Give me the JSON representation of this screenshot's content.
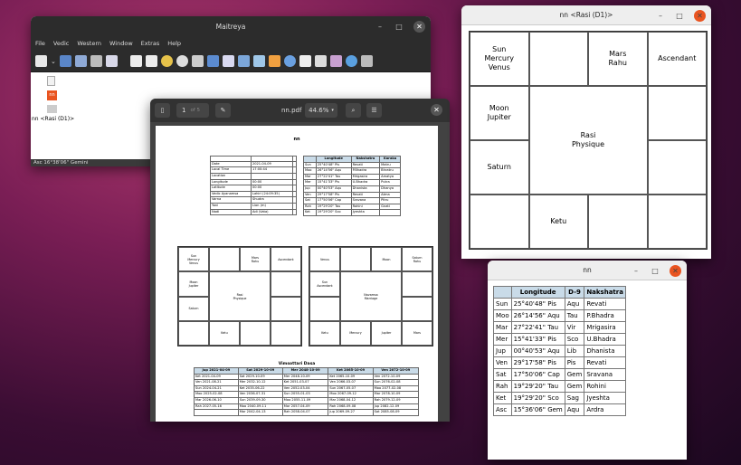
{
  "maitreya": {
    "title": "Maitreya",
    "menu": [
      "File",
      "Vedic",
      "Western",
      "Window",
      "Extras",
      "Help"
    ],
    "files": [
      {
        "name": "",
        "icon": "document-icon"
      },
      {
        "name": "",
        "icon": "nn-file-icon"
      },
      {
        "name": "",
        "icon": "dd-file-icon"
      },
      {
        "name": "nn <Rasi (D1)>",
        "icon": ""
      }
    ],
    "status": "Asc 16°38'06\" Gemini"
  },
  "pdf": {
    "title": "nn.pdf",
    "page_number": "1",
    "page_total": "of 5",
    "zoom": "44.6%",
    "doc_title": "nn",
    "basic_rows": [
      [
        "",
        "",
        ""
      ],
      [
        "Date",
        "2021-04-09",
        ""
      ],
      [
        "Local Time",
        "17:00:44",
        ""
      ],
      [
        "Location",
        "",
        ""
      ],
      [
        "Longitude",
        "00:00",
        ""
      ],
      [
        "Latitude",
        "00:00",
        ""
      ],
      [
        "Vedic Ayanamsa",
        "Lahiri (24:09:35)",
        ""
      ],
      [
        "Varna",
        "Shudra",
        ""
      ],
      [
        "Yoni",
        "Lion (m)",
        ""
      ],
      [
        "Nadi",
        "Adi (Vata)",
        ""
      ]
    ],
    "planet_headers": [
      "",
      "Longitude",
      "Nakshatra",
      "Karaka"
    ],
    "planet_rows": [
      [
        "Sun",
        "25°40'48\" Pis",
        "Revati",
        "Matru"
      ],
      [
        "Moo",
        "26°14'56\" Aqu",
        "P.Bhadra",
        "Bhratru"
      ],
      [
        "Mar",
        "27°22'41\" Tau",
        "Mrigasira",
        "Amatya"
      ],
      [
        "Mer",
        "15°41'33\" Pis",
        "U.Bhadra",
        "Putra"
      ],
      [
        "Jup",
        "00°40'53\" Aqu",
        "Dhanista",
        "Dhanya"
      ],
      [
        "Ven",
        "29°17'58\" Pis",
        "Revati",
        "Atma"
      ],
      [
        "Sat",
        "17°50'06\" Cap",
        "Sravana",
        "Pitru"
      ],
      [
        "Rah",
        "19°29'20\" Tau",
        "Rohini",
        "Gnati"
      ],
      [
        "Ket",
        "19°29'20\" Sco",
        "Jyeshta",
        ""
      ]
    ],
    "rasi_cells": {
      "c00": "Sun\nMercury\nVenus",
      "c01": "",
      "c02": "Mars\nRahu",
      "c03": "Ascendant",
      "c10": "Moon\nJupiter",
      "c13": "",
      "c20": "",
      "c23": "",
      "c30": "Saturn",
      "c31": "Ketu",
      "c32": "",
      "c33": "",
      "center": "Rasi\nPhysique"
    },
    "rasi_small_cells": {
      "c00": "Sun\nMercury\nVenus",
      "c01": "",
      "c02": "Mars\nRahu",
      "c03": "Ascendant",
      "c10": "Moon\nJupiter",
      "c13": "",
      "c20": "Saturn",
      "c23": "",
      "c30": "",
      "c31": "Ketu",
      "c32": "",
      "c33": "",
      "center": "Rasi\nPhysique"
    },
    "navamsa_cells": {
      "c00": "Venus",
      "c01": "",
      "c02": "Moon",
      "c03": "Saturn\nRahu",
      "c10": "Sun\nAscendant",
      "c13": "",
      "c20": "",
      "c23": "",
      "c30": "Ketu",
      "c31": "Mercury",
      "c32": "Jupiter",
      "c33": "Mars",
      "center": "Navamsa\nMarriage"
    },
    "dasa_title": "Vimsottari Dasa",
    "dasa_headers": [
      "Jup 2021-04-09",
      "Sat 2029-10-09",
      "Mer 2048-10-09",
      "Ket 2065-10-09",
      "Ven 2072-10-09"
    ],
    "dasa_rows": [
      [
        "Ket 2021-04-09",
        "Sat 2029-10-09",
        "Mer 2048-10-09",
        "Ket 2065-10-09",
        "Ven 2072-10-09"
      ],
      [
        "Ven 2021-08-21",
        "Mer 2032-10-12",
        "Ket 2051-03-07",
        "Ven 2066-03-07",
        "Sun 2076-02-08"
      ],
      [
        "Sun 2024-04-21",
        "Ket 2035-06-22",
        "Ven 2052-03-04",
        "Sun 2067-05-07",
        "Moo 2077-02-08"
      ],
      [
        "Moo 2025-02-08",
        "Ven 2036-07-31",
        "Sun 2055-01-03",
        "Moo 2067-09-12",
        "Mar 2078-10-09"
      ],
      [
        "Mar 2026-06-10",
        "Sun 2039-09-30",
        "Moo 2055-11-09",
        "Mar 2068-04-12",
        "Rah 2079-12-09"
      ],
      [
        "Rah 2027-05-16",
        "Moo 2040-09-11",
        "Mar 2057-04-09",
        "Rah 2068-09-08",
        "Jup 2082-12-09"
      ],
      [
        "",
        "Mar 2042-04-13",
        "Rah 2058-04-07",
        "Jup 2069-09-27",
        "Sat 2085-08-09"
      ]
    ]
  },
  "rasi_window": {
    "title": "nn <Rasi (D1)>",
    "cells": {
      "c00": "Sun\nMercury\nVenus",
      "c01": "",
      "c02": "Mars\nRahu",
      "c03": "Ascendant",
      "c10": "Moon\nJupiter",
      "c13": "",
      "c20": "Saturn",
      "c23": "",
      "c30": "",
      "c31": "Ketu",
      "c32": "",
      "c33": "",
      "center": "Rasi\nPhysique"
    }
  },
  "nn_window": {
    "title": "nn",
    "headers": [
      "",
      "Longitude",
      "D-9",
      "Nakshatra"
    ],
    "rows": [
      [
        "Sun",
        "25°40'48\" Pis",
        "Aqu",
        "Revati"
      ],
      [
        "Moo",
        "26°14'56\" Aqu",
        "Tau",
        "P.Bhadra"
      ],
      [
        "Mar",
        "27°22'41\" Tau",
        "Vir",
        "Mrigasira"
      ],
      [
        "Mer",
        "15°41'33\" Pis",
        "Sco",
        "U.Bhadra"
      ],
      [
        "Jup",
        "00°40'53\" Aqu",
        "Lib",
        "Dhanista"
      ],
      [
        "Ven",
        "29°17'58\" Pis",
        "Pis",
        "Revati"
      ],
      [
        "Sat",
        "17°50'06\" Cap",
        "Gem",
        "Sravana"
      ],
      [
        "Rah",
        "19°29'20\" Tau",
        "Gem",
        "Rohini"
      ],
      [
        "Ket",
        "19°29'20\" Sco",
        "Sag",
        "Jyeshta"
      ],
      [
        "Asc",
        "15°36'06\" Gem",
        "Aqu",
        "Ardra"
      ]
    ]
  }
}
